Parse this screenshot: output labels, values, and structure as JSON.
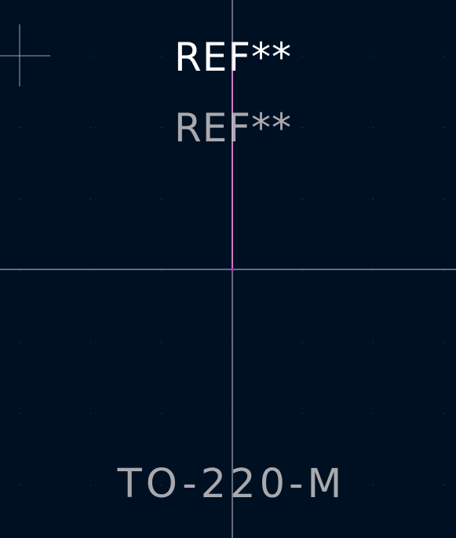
{
  "editor": {
    "reference_text": "REF**",
    "value_reference_text": "REF**",
    "footprint_value_text": "TO-220-M"
  },
  "colors": {
    "background": "#001023",
    "grid_dot": "#3a4658",
    "crosshair": "#c8c8d2",
    "origin_marker": "#a0a0aa",
    "silkscreen_text": "#ffffff",
    "fab_text": "#a9a9ad",
    "pad_line": "#c030c0"
  }
}
